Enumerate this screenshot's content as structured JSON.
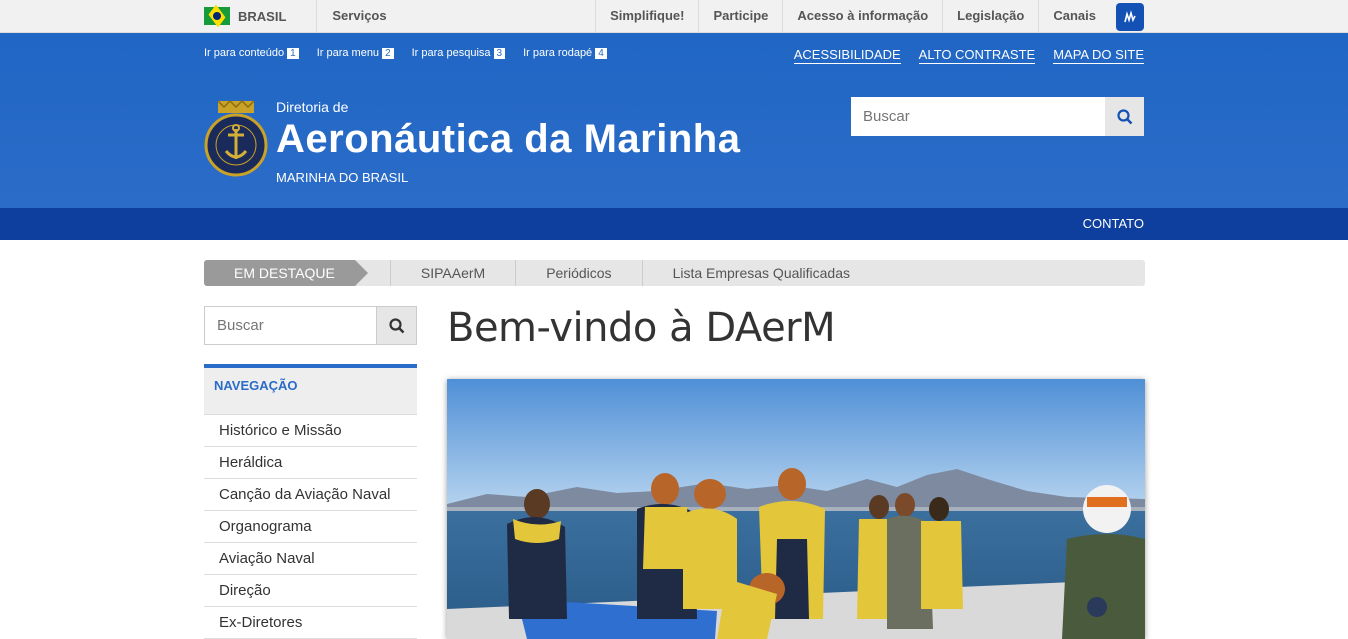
{
  "govbar": {
    "country": "BRASIL",
    "services": "Serviços",
    "links": [
      "Simplifique!",
      "Participe",
      "Acesso à informação",
      "Legislação",
      "Canais"
    ]
  },
  "skip_links": [
    {
      "label": "Ir para conteúdo",
      "key": "1"
    },
    {
      "label": "Ir para menu",
      "key": "2"
    },
    {
      "label": "Ir para pesquisa",
      "key": "3"
    },
    {
      "label": "Ir para rodapé",
      "key": "4"
    }
  ],
  "accessibility_links": [
    "ACESSIBILIDADE",
    "ALTO CONTRASTE",
    "MAPA DO SITE"
  ],
  "header": {
    "subtitle": "Diretoria de",
    "title": "Aeronáutica da Marinha",
    "org": "MARINHA DO BRASIL",
    "logo_text": "MARINHA DO BRASIL",
    "search_placeholder": "Buscar"
  },
  "service_bar": {
    "contact": "CONTATO"
  },
  "destaque": {
    "label": "EM DESTAQUE",
    "items": [
      "SIPAAerM",
      "Periódicos",
      "Lista Empresas Qualificadas"
    ]
  },
  "sidebar": {
    "search_placeholder": "Buscar",
    "nav_title": "NAVEGAÇÃO",
    "items": [
      "Histórico e Missão",
      "Heráldica",
      "Canção da Aviação Naval",
      "Organograma",
      "Aviação Naval",
      "Direção",
      "Ex-Diretores"
    ]
  },
  "main": {
    "title": "Bem-vindo à DAerM"
  },
  "colors": {
    "header_blue": "#2b6cc8",
    "service_bar": "#0e3f9e"
  }
}
